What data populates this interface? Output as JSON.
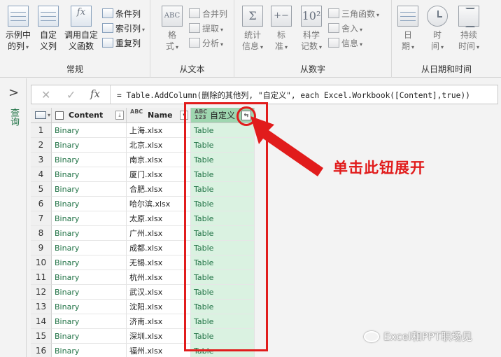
{
  "ribbon": {
    "groups": [
      {
        "label": "常规",
        "big_buttons": [
          {
            "label_line1": "示例中",
            "label_line2": "的列"
          },
          {
            "label_line1": "自定",
            "label_line2": "义列"
          },
          {
            "label_line1": "调用自定",
            "label_line2": "义函数"
          }
        ],
        "small_buttons": [
          "条件列",
          "索引列",
          "重复列"
        ]
      },
      {
        "label": "从文本",
        "big_buttons": [
          {
            "label_line1": "格",
            "label_line2": "式"
          }
        ],
        "small_buttons": [
          "合并列",
          "提取",
          "分析"
        ]
      },
      {
        "label": "从数字",
        "big_buttons": [
          {
            "label_line1": "统计",
            "label_line2": "信息"
          },
          {
            "label_line1": "标",
            "label_line2": "准"
          },
          {
            "label_line1": "科学",
            "label_line2": "记数"
          }
        ],
        "small_buttons": [
          "三角函数",
          "舍入",
          "信息"
        ]
      },
      {
        "label": "从日期和时间",
        "big_buttons": [
          {
            "label_line1": "日",
            "label_line2": "期"
          },
          {
            "label_line1": "时",
            "label_line2": "间"
          },
          {
            "label_line1": "持续",
            "label_line2": "时间"
          }
        ]
      }
    ]
  },
  "sidebar": {
    "toggle": ">",
    "label": "查询"
  },
  "formula_bar": {
    "cancel": "✕",
    "confirm": "✓",
    "fx": "fx",
    "formula": "= Table.AddColumn(删除的其他列, \"自定义\", each Excel.Workbook([Content],true))"
  },
  "grid": {
    "columns": [
      {
        "type_icon": "ABC",
        "name": "Content"
      },
      {
        "type_icon": "ABC",
        "name": "Name"
      },
      {
        "type_icon": "ABC 123",
        "name": "自定义"
      }
    ],
    "expand_icon": "⇆",
    "rows": [
      {
        "num": "1",
        "content": "Binary",
        "name": "上海.xlsx",
        "custom": "Table"
      },
      {
        "num": "2",
        "content": "Binary",
        "name": "北京.xlsx",
        "custom": "Table"
      },
      {
        "num": "3",
        "content": "Binary",
        "name": "南京.xlsx",
        "custom": "Table"
      },
      {
        "num": "4",
        "content": "Binary",
        "name": "厦门.xlsx",
        "custom": "Table"
      },
      {
        "num": "5",
        "content": "Binary",
        "name": "合肥.xlsx",
        "custom": "Table"
      },
      {
        "num": "6",
        "content": "Binary",
        "name": "哈尔滨.xlsx",
        "custom": "Table"
      },
      {
        "num": "7",
        "content": "Binary",
        "name": "太原.xlsx",
        "custom": "Table"
      },
      {
        "num": "8",
        "content": "Binary",
        "name": "广州.xlsx",
        "custom": "Table"
      },
      {
        "num": "9",
        "content": "Binary",
        "name": "成都.xlsx",
        "custom": "Table"
      },
      {
        "num": "10",
        "content": "Binary",
        "name": "无锡.xlsx",
        "custom": "Table"
      },
      {
        "num": "11",
        "content": "Binary",
        "name": "杭州.xlsx",
        "custom": "Table"
      },
      {
        "num": "12",
        "content": "Binary",
        "name": "武汉.xlsx",
        "custom": "Table"
      },
      {
        "num": "13",
        "content": "Binary",
        "name": "沈阳.xlsx",
        "custom": "Table"
      },
      {
        "num": "14",
        "content": "Binary",
        "name": "济南.xlsx",
        "custom": "Table"
      },
      {
        "num": "15",
        "content": "Binary",
        "name": "深圳.xlsx",
        "custom": "Table"
      },
      {
        "num": "16",
        "content": "Binary",
        "name": "福州.xlsx",
        "custom": "Table"
      }
    ]
  },
  "annotation": {
    "text": "单击此钮展开",
    "color": "#e11c1c"
  },
  "watermark": {
    "text": "Excel和PPT职场见"
  },
  "colors": {
    "accent_green": "#217346",
    "selected_column": "#daf2e1",
    "annotation_red": "#e11c1c"
  }
}
